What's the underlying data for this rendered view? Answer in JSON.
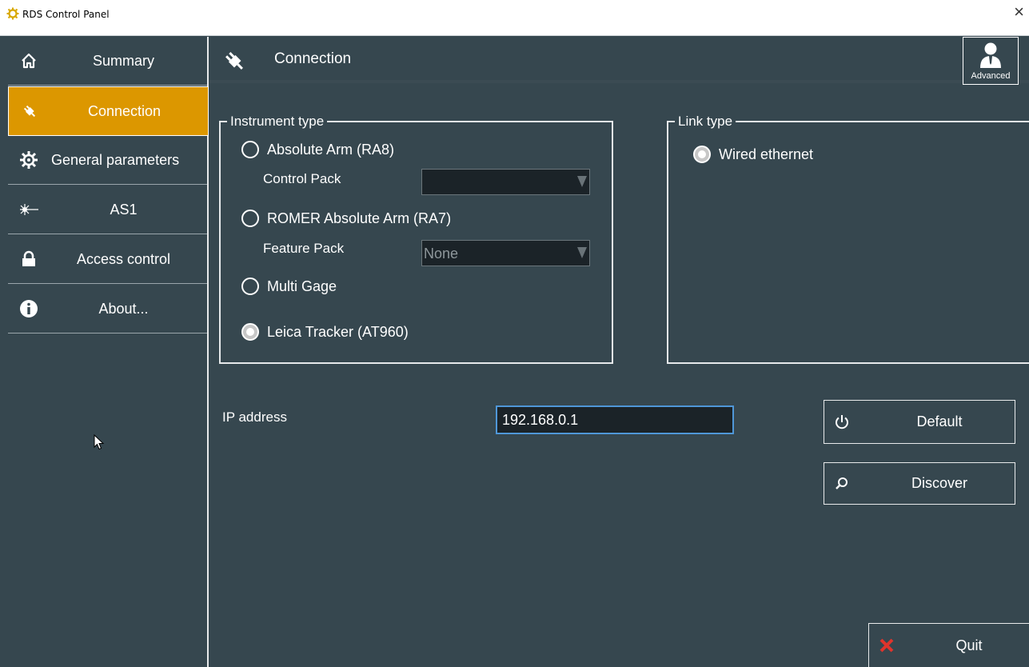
{
  "window": {
    "title": "RDS Control Panel",
    "close_glyph": "×"
  },
  "sidebar": {
    "items": [
      {
        "label": "Summary",
        "icon": "home-icon",
        "active": false
      },
      {
        "label": "Connection",
        "icon": "plug-icon",
        "active": true
      },
      {
        "label": "General parameters",
        "icon": "gear-icon",
        "active": false
      },
      {
        "label": "AS1",
        "icon": "laser-icon",
        "active": false
      },
      {
        "label": "Access control",
        "icon": "lock-icon",
        "active": false
      },
      {
        "label": "About...",
        "icon": "info-icon",
        "active": false
      }
    ]
  },
  "header": {
    "title": "Connection",
    "advanced_label": "Advanced"
  },
  "instrument_type": {
    "legend": "Instrument type",
    "options": [
      {
        "label": "Absolute Arm (RA8)",
        "selected": false
      },
      {
        "label": "ROMER Absolute Arm (RA7)",
        "selected": false
      },
      {
        "label": "Multi Gage",
        "selected": false
      },
      {
        "label": "Leica Tracker (AT960)",
        "selected": true
      }
    ],
    "control_pack": {
      "label": "Control Pack",
      "value": ""
    },
    "feature_pack": {
      "label": "Feature Pack",
      "value": "None"
    }
  },
  "link_type": {
    "legend": "Link type",
    "options": [
      {
        "label": "Wired ethernet",
        "selected": true
      }
    ]
  },
  "ip": {
    "label": "IP address",
    "value": "192.168.0.1"
  },
  "buttons": {
    "default_label": "Default",
    "discover_label": "Discover",
    "quit_label": "Quit"
  },
  "colors": {
    "background": "#36474f",
    "accent_active": "#dc9700",
    "input_bg": "#1b2328",
    "focus_border": "#4f97d8",
    "quit_icon": "#e0342c"
  }
}
